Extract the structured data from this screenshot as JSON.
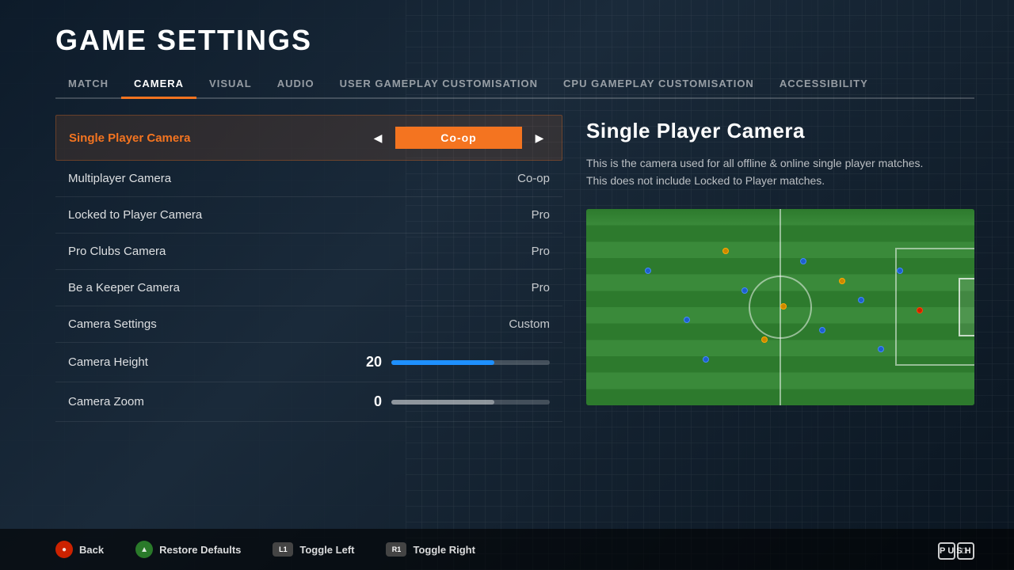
{
  "page": {
    "title": "GAME SETTINGS"
  },
  "tabs": [
    {
      "id": "match",
      "label": "MATCH",
      "active": false
    },
    {
      "id": "camera",
      "label": "CAMERA",
      "active": true
    },
    {
      "id": "visual",
      "label": "VISUAL",
      "active": false
    },
    {
      "id": "audio",
      "label": "AUDIO",
      "active": false
    },
    {
      "id": "user-gameplay",
      "label": "USER GAMEPLAY CUSTOMISATION",
      "active": false
    },
    {
      "id": "cpu-gameplay",
      "label": "CPU GAMEPLAY CUSTOMISATION",
      "active": false
    },
    {
      "id": "accessibility",
      "label": "ACCESSIBILITY",
      "active": false
    }
  ],
  "settings": [
    {
      "id": "single-player-camera",
      "label": "Single Player Camera",
      "value": "Co-op",
      "type": "selector",
      "active": true
    },
    {
      "id": "multiplayer-camera",
      "label": "Multiplayer Camera",
      "value": "Co-op",
      "type": "value",
      "active": false
    },
    {
      "id": "locked-to-player-camera",
      "label": "Locked to Player Camera",
      "value": "Pro",
      "type": "value",
      "active": false
    },
    {
      "id": "pro-clubs-camera",
      "label": "Pro Clubs Camera",
      "value": "Pro",
      "type": "value",
      "active": false
    },
    {
      "id": "be-a-keeper-camera",
      "label": "Be a Keeper Camera",
      "value": "Pro",
      "type": "value",
      "active": false
    },
    {
      "id": "camera-settings",
      "label": "Camera Settings",
      "value": "Custom",
      "type": "value",
      "active": false
    }
  ],
  "sliders": [
    {
      "id": "camera-height",
      "label": "Camera Height",
      "value": 20,
      "fill": 65,
      "color": "blue"
    },
    {
      "id": "camera-zoom",
      "label": "Camera Zoom",
      "value": 0,
      "fill": 65,
      "color": "gray"
    }
  ],
  "info": {
    "title": "Single Player Camera",
    "description": "This is the camera used for all offline & online single player matches.\nThis does not include Locked to Player matches."
  },
  "bottom_actions": [
    {
      "id": "back",
      "button": "circle",
      "label": "Back",
      "button_text": "●"
    },
    {
      "id": "restore",
      "button": "triangle",
      "label": "Restore Defaults",
      "button_text": "▲"
    },
    {
      "id": "toggle-left",
      "button": "l1",
      "label": "Toggle Left",
      "button_text": "L1"
    },
    {
      "id": "toggle-right",
      "button": "r1",
      "label": "Toggle Right",
      "button_text": "R1"
    }
  ],
  "push_logo": "PUSH"
}
